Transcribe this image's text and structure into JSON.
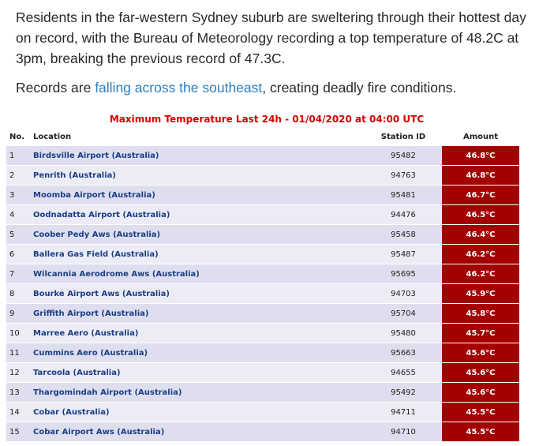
{
  "intro": {
    "paragraph1": "Residents in the far-western Sydney suburb are sweltering through their hottest day on record, with the Bureau of Meteorology recording a top temperature of 48.2C at 3pm, breaking the previous record of 47.3C.",
    "paragraph2_before": "Records are ",
    "paragraph2_link": "falling across the southeast",
    "paragraph2_after": ", creating deadly fire conditions."
  },
  "table": {
    "title": "Maximum Temperature Last 24h - 01/04/2020 at 04:00 UTC",
    "headers": {
      "no": "No.",
      "location": "Location",
      "station_id": "Station ID",
      "amount": "Amount"
    },
    "rows": [
      {
        "no": "1",
        "location": "Birdsville Airport (Australia)",
        "station_id": "95482",
        "amount": "46.8°C"
      },
      {
        "no": "2",
        "location": "Penrith (Australia)",
        "station_id": "94763",
        "amount": "46.8°C"
      },
      {
        "no": "3",
        "location": "Moomba Airport (Australia)",
        "station_id": "95481",
        "amount": "46.7°C"
      },
      {
        "no": "4",
        "location": "Oodnadatta Airport (Australia)",
        "station_id": "94476",
        "amount": "46.5°C"
      },
      {
        "no": "5",
        "location": "Coober Pedy Aws (Australia)",
        "station_id": "95458",
        "amount": "46.4°C"
      },
      {
        "no": "6",
        "location": "Ballera Gas Field (Australia)",
        "station_id": "95487",
        "amount": "46.2°C"
      },
      {
        "no": "7",
        "location": "Wilcannia Aerodrome Aws (Australia)",
        "station_id": "95695",
        "amount": "46.2°C"
      },
      {
        "no": "8",
        "location": "Bourke Airport Aws (Australia)",
        "station_id": "94703",
        "amount": "45.9°C"
      },
      {
        "no": "9",
        "location": "Griffith Airport (Australia)",
        "station_id": "95704",
        "amount": "45.8°C"
      },
      {
        "no": "10",
        "location": "Marree Aero (Australia)",
        "station_id": "95480",
        "amount": "45.7°C"
      },
      {
        "no": "11",
        "location": "Cummins Aero (Australia)",
        "station_id": "95663",
        "amount": "45.6°C"
      },
      {
        "no": "12",
        "location": "Tarcoola (Australia)",
        "station_id": "94655",
        "amount": "45.6°C"
      },
      {
        "no": "13",
        "location": "Thargomindah Airport (Australia)",
        "station_id": "95492",
        "amount": "45.6°C"
      },
      {
        "no": "14",
        "location": "Cobar (Australia)",
        "station_id": "94711",
        "amount": "45.5°C"
      },
      {
        "no": "15",
        "location": "Cobar Airport Aws (Australia)",
        "station_id": "94710",
        "amount": "45.5°C"
      }
    ]
  },
  "colors": {
    "title_red": "#d30000",
    "amount_bg": "#a30000",
    "link_blue": "#2a7fc0",
    "row_odd": "#dedeee",
    "row_even": "#ececf6"
  }
}
